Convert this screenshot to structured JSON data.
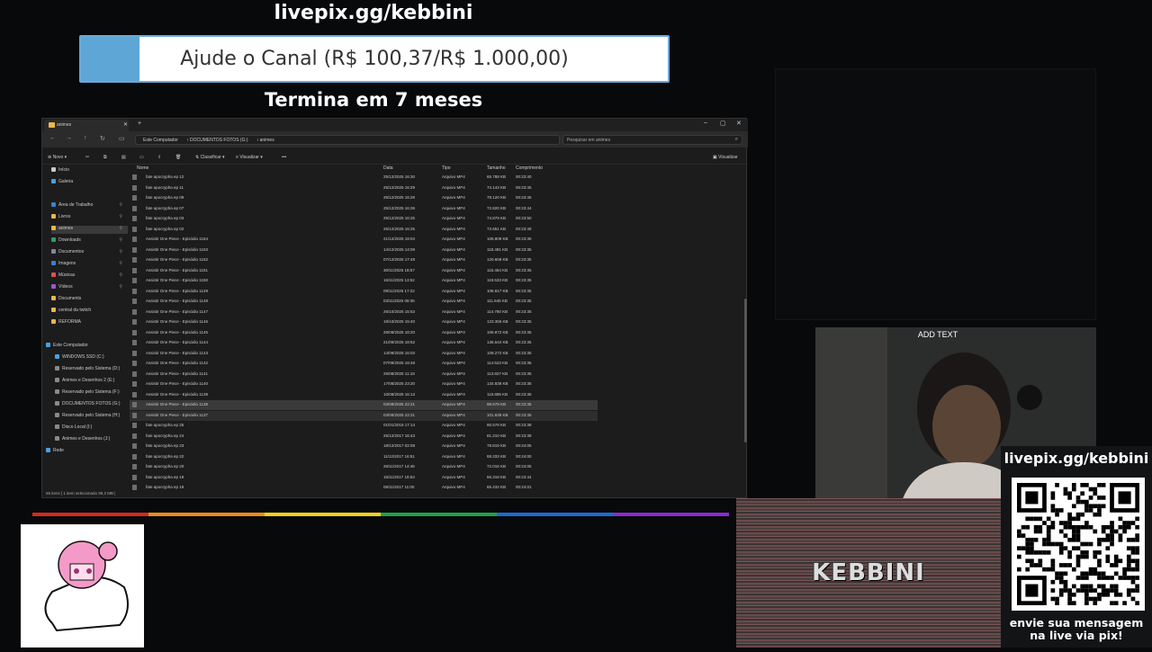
{
  "overlay": {
    "donate_url": "livepix.gg/kebbini",
    "goal_text": "Ajude o Canal (R$ 100,37/R$ 1.000,00)",
    "goal_progress": 0.10037,
    "ends_text": "Termina em 7 meses"
  },
  "explorer": {
    "tab_label": "animes",
    "breadcrumb": [
      "Este Computador",
      "DOCUMENTOS FOTOS (G:)",
      "animes"
    ],
    "search_placeholder": "Pesquisar em animes",
    "toolbar": {
      "new": "Novo",
      "sort": "Classificar",
      "view": "Visualizar",
      "more": "•••",
      "details": "Visualizar"
    },
    "sidebar": {
      "top": [
        "Início",
        "Galeria"
      ],
      "pinned": [
        "Área de Trabalho",
        "Livros",
        "animes",
        "Downloads",
        "Documentos",
        "Imagens",
        "Músicas",
        "Vídeos",
        "Documents",
        "central da twitch",
        "REFORMA"
      ],
      "this_pc": "Este Computador",
      "drives": [
        "WINDOWS SSD (C:)",
        "Reservado pelo Sistema (D:)",
        "Animes e Desenhos 2 (E:)",
        "Reservado pelo Sistema (F:)",
        "DOCUMENTOS FOTOS (G:)",
        "Reservado pelo Sistema (H:)",
        "Disco Local (I:)",
        "Animes e Desenhos (J:)"
      ],
      "network": "Rede"
    },
    "columns": {
      "name": "Nome",
      "date": "Data",
      "type": "Tipo",
      "size": "Tamanho",
      "length": "Comprimento"
    },
    "files": [
      {
        "name": "fate apocrypha ep 12",
        "date": "25/12/2025 16:30",
        "type": "Arquivo MP4",
        "size": "65.788 KB",
        "length": "00:23:40"
      },
      {
        "name": "fate apocrypha ep 11",
        "date": "25/12/2025 16:29",
        "type": "Arquivo MP4",
        "size": "74.143 KB",
        "length": "00:23:45"
      },
      {
        "name": "fate apocrypha ep 09",
        "date": "25/12/2025 16:28",
        "type": "Arquivo MP4",
        "size": "78.120 KB",
        "length": "00:23:45"
      },
      {
        "name": "fate apocrypha ep 07",
        "date": "25/12/2025 16:26",
        "type": "Arquivo MP4",
        "size": "72.820 KB",
        "length": "00:23:44"
      },
      {
        "name": "fate apocrypha ep 03",
        "date": "25/12/2025 16:25",
        "type": "Arquivo MP4",
        "size": "74.879 KB",
        "length": "00:23:50"
      },
      {
        "name": "fate apocrypha ep 02",
        "date": "25/12/2025 16:25",
        "type": "Arquivo MP4",
        "size": "72.651 KB",
        "length": "00:23:49"
      },
      {
        "name": "Assistir One Piece - Episódio 1154",
        "date": "21/12/2025 18:04",
        "type": "Arquivo MP4",
        "size": "109.809 KB",
        "length": "00:23:35"
      },
      {
        "name": "Assistir One Piece - Episódio 1153",
        "date": "14/12/2025 14:09",
        "type": "Arquivo MP4",
        "size": "118.481 KB",
        "length": "00:23:35"
      },
      {
        "name": "Assistir One Piece - Episódio 1152",
        "date": "07/12/2025 17:48",
        "type": "Arquivo MP4",
        "size": "120.658 KB",
        "length": "00:23:35"
      },
      {
        "name": "Assistir One Piece - Episódio 1151",
        "date": "30/11/2025 18:57",
        "type": "Arquivo MP4",
        "size": "115.464 KB",
        "length": "00:23:35"
      },
      {
        "name": "Assistir One Piece - Episódio 1150",
        "date": "16/11/2025 13:52",
        "type": "Arquivo MP4",
        "size": "119.533 KB",
        "length": "00:23:35"
      },
      {
        "name": "Assistir One Piece - Episódio 1149",
        "date": "09/11/2025 17:22",
        "type": "Arquivo MP4",
        "size": "106.817 KB",
        "length": "00:23:35"
      },
      {
        "name": "Assistir One Piece - Episódio 1148",
        "date": "03/11/2025 08:36",
        "type": "Arquivo MP4",
        "size": "111.645 KB",
        "length": "00:23:35"
      },
      {
        "name": "Assistir One Piece - Episódio 1147",
        "date": "26/10/2025 15:53",
        "type": "Arquivo MP4",
        "size": "114.780 KB",
        "length": "00:23:35"
      },
      {
        "name": "Assistir One Piece - Episódio 1146",
        "date": "19/10/2025 15:40",
        "type": "Arquivo MP4",
        "size": "123.355 KB",
        "length": "00:23:35"
      },
      {
        "name": "Assistir One Piece - Episódio 1145",
        "date": "28/09/2025 18:20",
        "type": "Arquivo MP4",
        "size": "109.872 KB",
        "length": "00:23:35"
      },
      {
        "name": "Assistir One Piece - Episódio 1144",
        "date": "21/09/2025 18:52",
        "type": "Arquivo MP4",
        "size": "136.544 KB",
        "length": "00:23:35"
      },
      {
        "name": "Assistir One Piece - Episódio 1143",
        "date": "14/09/2025 16:03",
        "type": "Arquivo MP4",
        "size": "109.272 KB",
        "length": "00:23:35"
      },
      {
        "name": "Assistir One Piece - Episódio 1142",
        "date": "07/09/2025 18:48",
        "type": "Arquivo MP4",
        "size": "114.523 KB",
        "length": "00:23:35"
      },
      {
        "name": "Assistir One Piece - Episódio 1141",
        "date": "25/08/2025 11:18",
        "type": "Arquivo MP4",
        "size": "113.827 KB",
        "length": "00:23:35"
      },
      {
        "name": "Assistir One Piece - Episódio 1140",
        "date": "17/08/2025 23:20",
        "type": "Arquivo MP4",
        "size": "134.838 KB",
        "length": "00:23:35"
      },
      {
        "name": "Assistir One Piece - Episódio 1139",
        "date": "10/08/2025 16:13",
        "type": "Arquivo MP4",
        "size": "115.895 KB",
        "length": "00:23:35"
      },
      {
        "name": "Assistir One Piece - Episódio 1138",
        "date": "03/08/2025 22:21",
        "type": "Arquivo MP4",
        "size": "98.679 KB",
        "length": "00:23:35"
      },
      {
        "name": "Assistir One Piece - Episódio 1137",
        "date": "03/08/2025 22:21",
        "type": "Arquivo MP4",
        "size": "101.639 KB",
        "length": "00:23:35"
      },
      {
        "name": "fate apocrypha ep 25",
        "date": "01/01/2018 17:14",
        "type": "Arquivo MP4",
        "size": "80.578 KB",
        "length": "00:23:38"
      },
      {
        "name": "fate apocrypha ep 24",
        "date": "25/12/2017 16:43",
        "type": "Arquivo MP4",
        "size": "81.210 KB",
        "length": "00:23:39"
      },
      {
        "name": "fate apocrypha ep 23",
        "date": "18/12/2017 02:09",
        "type": "Arquivo MP4",
        "size": "78.819 KB",
        "length": "00:24:05"
      },
      {
        "name": "fate apocrypha ep 22",
        "date": "11/12/2017 16:51",
        "type": "Arquivo MP4",
        "size": "88.333 KB",
        "length": "00:24:00"
      },
      {
        "name": "fate apocrypha ep 20",
        "date": "26/11/2017 14:46",
        "type": "Arquivo MP4",
        "size": "72.016 KB",
        "length": "00:24:05"
      },
      {
        "name": "fate apocrypha ep 19",
        "date": "15/11/2017 18:53",
        "type": "Arquivo MP4",
        "size": "66.318 KB",
        "length": "00:23:44"
      },
      {
        "name": "fate apocrypha ep 18",
        "date": "06/11/2017 11:00",
        "type": "Arquivo MP4",
        "size": "65.432 KB",
        "length": "00:24:01"
      }
    ],
    "status": "65 itens  |  1 item selecionado 99,2 MB  |"
  },
  "webcam": {
    "add_text": "ADD TEXT"
  },
  "qr_panel": {
    "url": "livepix.gg/kebbini",
    "message": "envie sua mensagem na live via pix!"
  },
  "banner": {
    "name": "KEBBINI"
  },
  "colors": {
    "goal_fill": "#5ea6d6",
    "rainbow": [
      "#d22a1e",
      "#f08a1c",
      "#f0d21c",
      "#1fa34a",
      "#1c6ad2",
      "#8a2ad2"
    ]
  }
}
